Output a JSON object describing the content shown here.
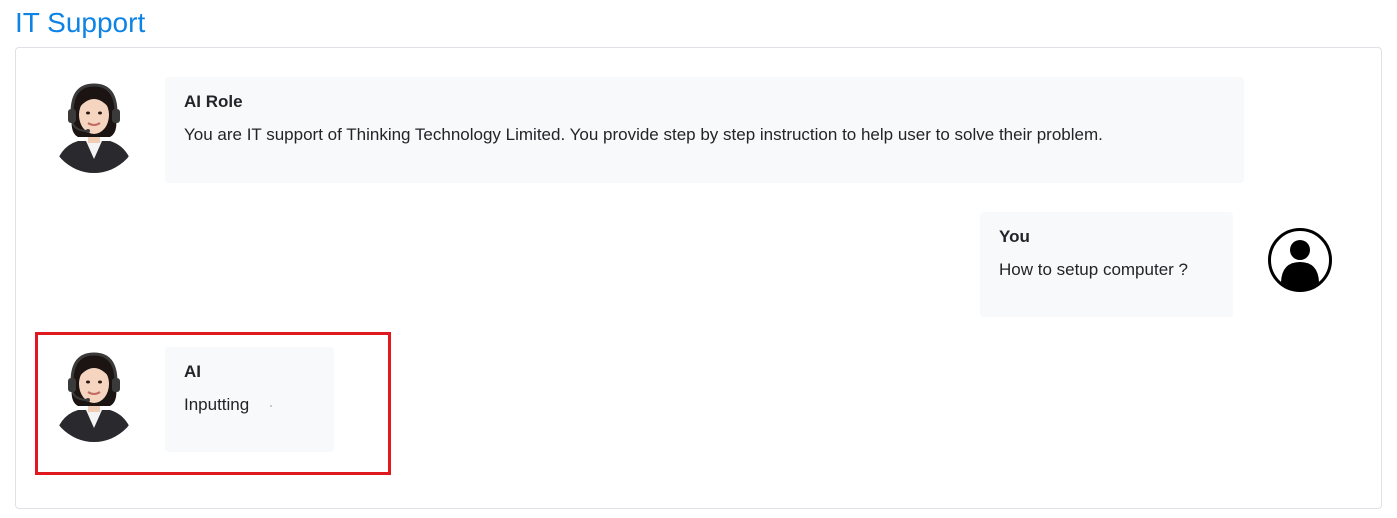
{
  "header": {
    "title": "IT Support"
  },
  "messages": [
    {
      "role": "agent",
      "sender": "AI Role",
      "text": "You are IT support of Thinking Technology Limited. You provide step by step instruction to help user to solve their problem.",
      "avatar_icon": "support-agent-headset-avatar"
    },
    {
      "role": "user",
      "sender": "You",
      "text": "How to setup computer ?",
      "avatar_icon": "user-silhouette-icon"
    },
    {
      "role": "agent",
      "sender": "AI",
      "text": "Inputting",
      "avatar_icon": "support-agent-headset-avatar"
    }
  ],
  "colors": {
    "title": "#0d83e6",
    "bubble_bg": "#f8f9fa",
    "highlight_border": "#e0191f"
  }
}
